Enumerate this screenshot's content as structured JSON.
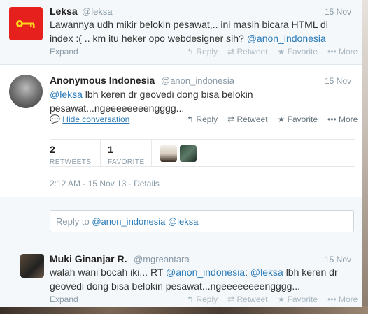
{
  "tweets": [
    {
      "name": "Leksa",
      "handle": "@leksa",
      "time": "15 Nov",
      "text_plain": "Lawannya udh mikir belokin pesawat,.. ini masih bicara HTML di index :( .. km itu heker opo webdesigner sih?",
      "mention": "@anon_indonesia",
      "expand": "Expand",
      "actions": {
        "reply": "Reply",
        "retweet": "Retweet",
        "favorite": "Favorite",
        "more": "More"
      }
    },
    {
      "name": "Anonymous Indonesia",
      "handle": "@anon_indonesia",
      "time": "15 Nov",
      "mention": "@leksa",
      "text_plain": "lbh keren dr geovedi dong bisa belokin pesawat...ngeeeeeeeengggg...",
      "hide_conversation": "Hide conversation",
      "actions": {
        "reply": "Reply",
        "retweet": "Retweet",
        "favorite": "Favorite",
        "more": "More"
      },
      "retweets_count": "2",
      "retweets_label": "RETWEETS",
      "favorites_count": "1",
      "favorites_label": "FAVORITE",
      "timestamp": "2:12 AM - 15 Nov 13",
      "details": "Details",
      "reply_to_prefix": "Reply to",
      "reply_to_mentions": [
        "@anon_indonesia",
        "@leksa"
      ]
    },
    {
      "name": "Muki Ginanjar R.",
      "handle": "@mgreantara",
      "time": "15 Nov",
      "text_prefix": "walah wani bocah iki... RT",
      "mention1": "@anon_indonesia",
      "colon": ":",
      "mention2": "@leksa",
      "text_suffix": "lbh keren dr geovedi dong bisa belokin pesawat...ngeeeeeeeengggg...",
      "expand": "Expand",
      "actions": {
        "reply": "Reply",
        "retweet": "Retweet",
        "favorite": "Favorite",
        "more": "More"
      }
    }
  ],
  "icons": {
    "reply": "reply-arrow-icon",
    "retweet": "retweet-icon",
    "favorite": "star-icon",
    "more": "ellipsis-icon",
    "conversation": "speech-bubble-icon",
    "avatar1_logo": "key-icon"
  },
  "colors": {
    "link": "#2b7bb9",
    "muted": "#8899a6",
    "leksa_avatar_bg": "#e6201c",
    "key_yellow": "#ffd21e"
  }
}
